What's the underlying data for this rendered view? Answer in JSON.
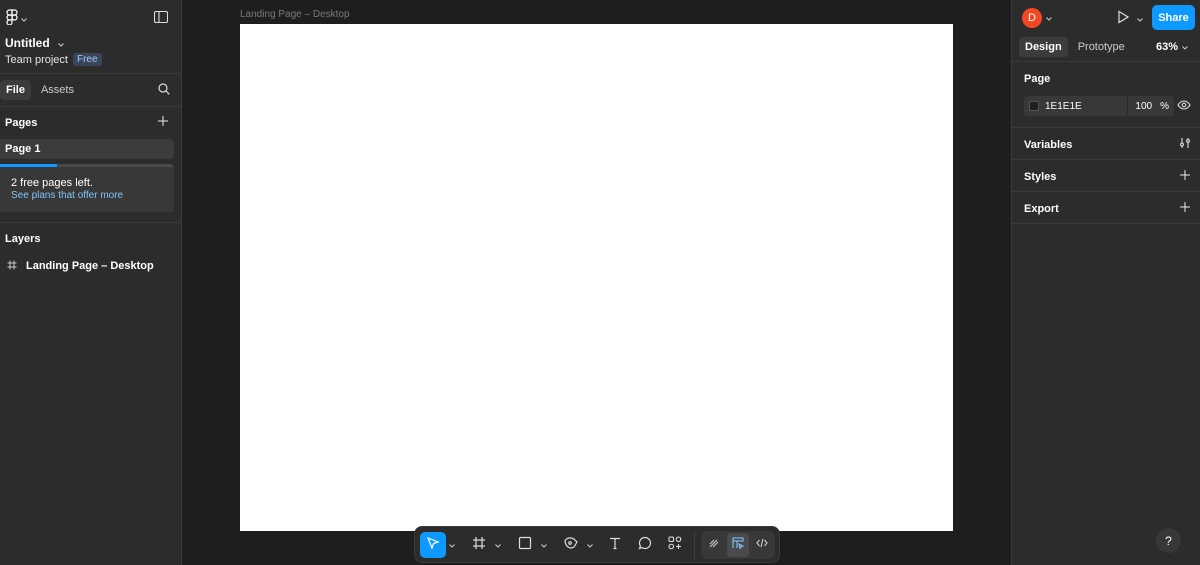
{
  "file": {
    "name": "Untitled",
    "project": "Team project",
    "plan_badge": "Free"
  },
  "left_tabs": [
    "File",
    "Assets"
  ],
  "pages": {
    "title": "Pages",
    "items": [
      "Page 1"
    ],
    "free_notice": "2 free pages left.",
    "free_link": "See plans that offer more",
    "usage_fraction": 0.33
  },
  "layers": {
    "title": "Layers",
    "items": [
      "Landing Page – Desktop"
    ]
  },
  "canvas": {
    "frame_label": "Landing Page – Desktop"
  },
  "right_panel": {
    "avatar_initial": "D",
    "share_label": "Share",
    "tabs": [
      "Design",
      "Prototype"
    ],
    "zoom": "63%",
    "page_section": {
      "title": "Page",
      "color_hex": "1E1E1E",
      "opacity": "100",
      "opacity_unit": "%"
    },
    "sections": [
      "Variables",
      "Styles",
      "Export"
    ],
    "help": "?"
  },
  "colors": {
    "accent": "#0d99ff",
    "avatar": "#f24822",
    "canvas_bg": "#1e1e1e",
    "frame_bg": "#ffffff"
  },
  "icons": [
    "figma-logo-icon",
    "sidebar-toggle-icon",
    "search-icon",
    "plus-icon",
    "frame-hash-icon",
    "move-cursor-icon",
    "frame-tool-icon",
    "rectangle-tool-icon",
    "pen-tool-icon",
    "text-tool-icon",
    "comment-icon",
    "actions-icon",
    "draw-mode-icon",
    "design-mode-icon",
    "dev-mode-icon",
    "play-icon",
    "eye-icon",
    "variables-icon"
  ]
}
